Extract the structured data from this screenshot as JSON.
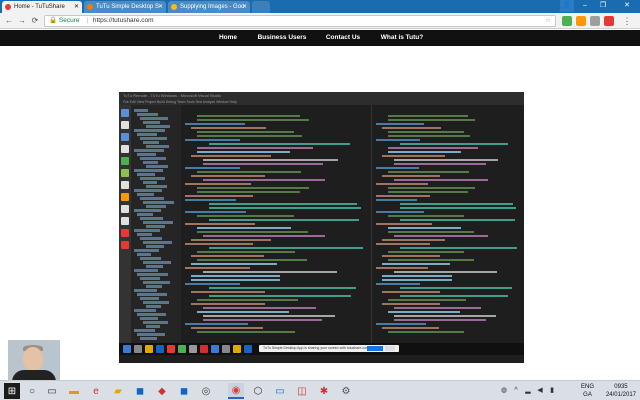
{
  "browser": {
    "tabs": [
      {
        "title": "Home - TuTuShare",
        "favicon_color": "#e53935",
        "active": true
      },
      {
        "title": "TuTu Simple Desktop S",
        "favicon_color": "#f57c00",
        "active": false
      },
      {
        "title": "Supplying Images - Goo",
        "favicon_color": "#fbbc05",
        "active": false
      }
    ],
    "address": {
      "secure_label": "Secure",
      "url": "https://tutushare.com"
    },
    "window_controls": {
      "minimize": "–",
      "maximize": "❐",
      "close": "✕"
    },
    "nav": {
      "back": "←",
      "forward": "→",
      "reload": "⟳",
      "star": "☆"
    }
  },
  "site_nav": {
    "items": [
      "Home",
      "Business Users",
      "Contact Us",
      "What is Tutu?"
    ]
  },
  "embedded": {
    "title": "TuTu Remote - TuTu Windows - Microsoft Visual Studio",
    "menu": "File  Edit  View  Project  Build  Debug  Team  Tools  Test  Analyze  Window  Help",
    "notification": "TuTu Simple Desktop App is sharing your screen with tutushare.com"
  },
  "taskbar": {
    "lang_top": "ENG",
    "lang_bottom": "GA",
    "time": "0935",
    "date": "24/01/2017",
    "icons": [
      "start-icon",
      "search-icon",
      "task-view-icon",
      "folder-icon",
      "edge-icon",
      "chrome-icon",
      "store-icon",
      "vs-icon",
      "box-icon",
      "terminal-icon",
      "pdf-icon",
      "tool-icon",
      "settings-icon"
    ]
  }
}
